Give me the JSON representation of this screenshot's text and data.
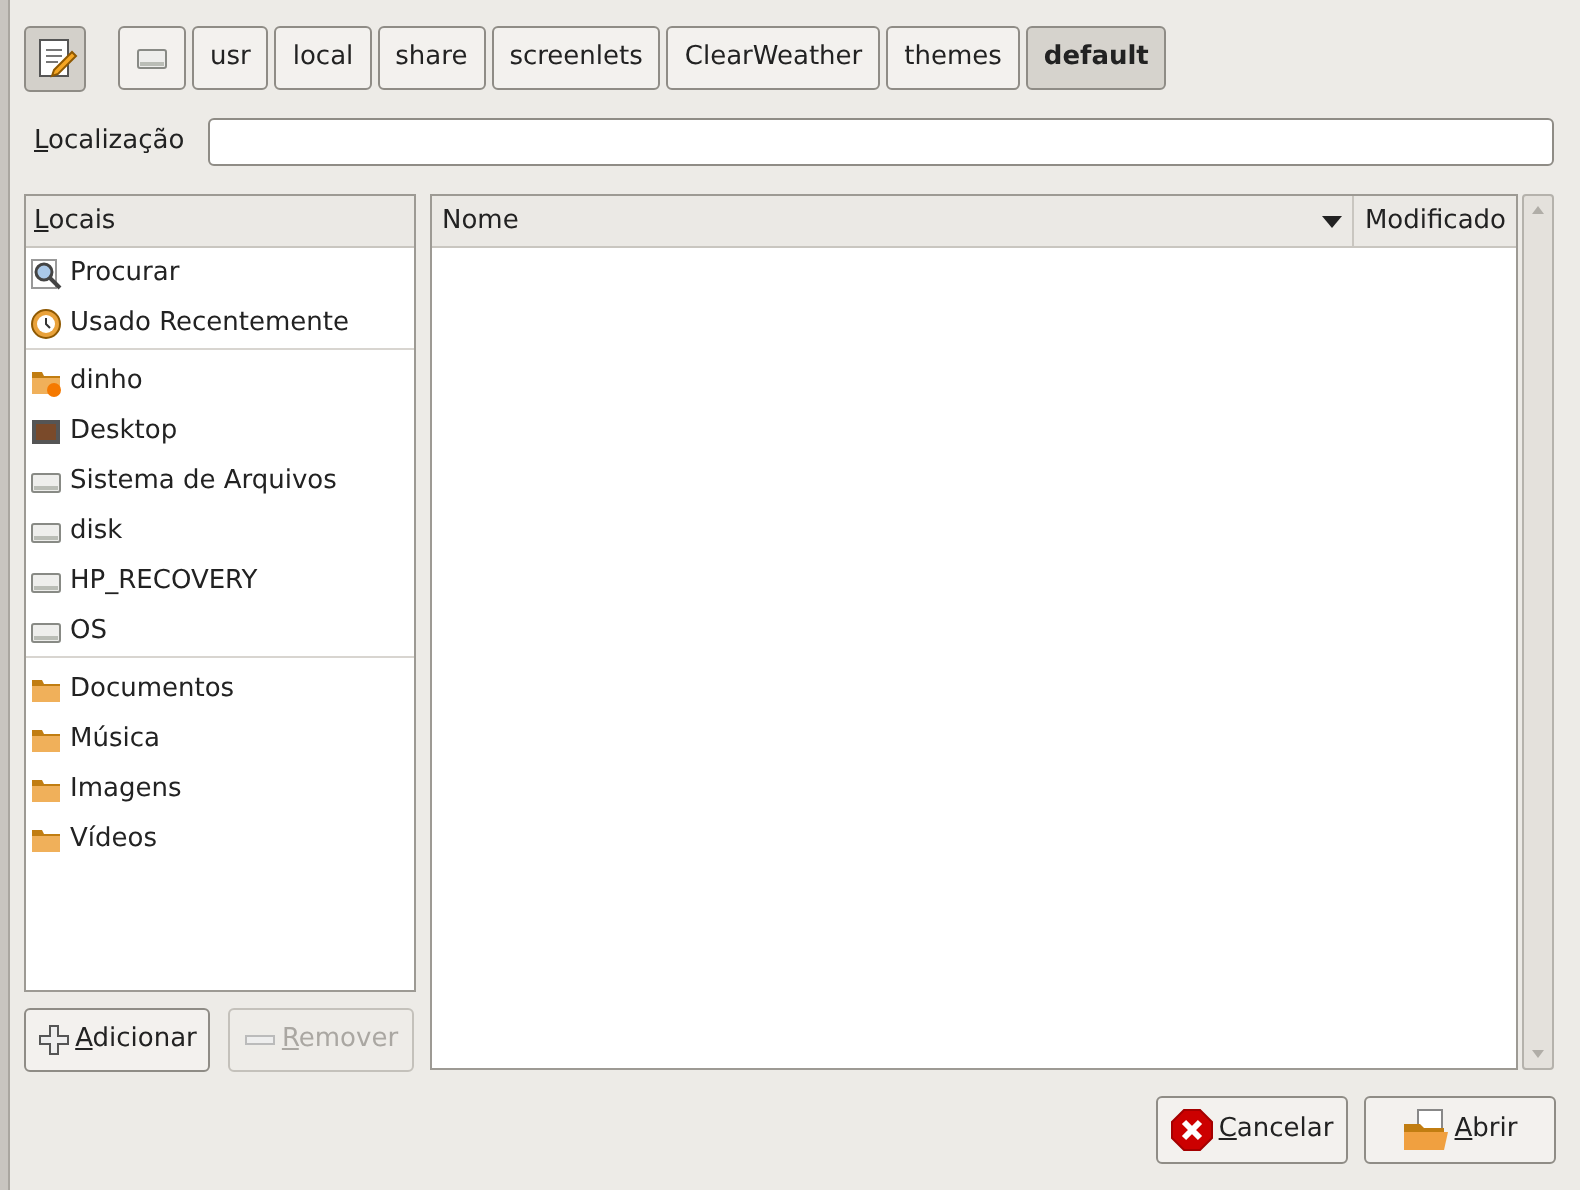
{
  "path_bar": {
    "edit_toggle": {
      "pressed": true
    },
    "segments": [
      {
        "kind": "drive",
        "selected": false
      },
      {
        "kind": "text",
        "label": "usr",
        "selected": false
      },
      {
        "kind": "text",
        "label": "local",
        "selected": false
      },
      {
        "kind": "text",
        "label": "share",
        "selected": false
      },
      {
        "kind": "text",
        "label": "screenlets",
        "selected": false
      },
      {
        "kind": "text",
        "label": "ClearWeather",
        "selected": false
      },
      {
        "kind": "text",
        "label": "themes",
        "selected": false
      },
      {
        "kind": "text",
        "label": "default",
        "selected": true
      }
    ]
  },
  "location": {
    "label": "Localização"
  },
  "places": {
    "header": "Locais",
    "groups": [
      [
        {
          "kind": "search",
          "label": "Procurar"
        },
        {
          "kind": "recent",
          "label": "Usado Recentemente"
        }
      ],
      [
        {
          "kind": "home",
          "label": "dinho"
        },
        {
          "kind": "desktop",
          "label": "Desktop"
        },
        {
          "kind": "drive",
          "label": "Sistema de Arquivos"
        },
        {
          "kind": "drive",
          "label": "disk"
        },
        {
          "kind": "drive",
          "label": "HP_RECOVERY"
        },
        {
          "kind": "drive",
          "label": "OS"
        }
      ],
      [
        {
          "kind": "folder",
          "label": "Documentos"
        },
        {
          "kind": "folder",
          "label": "Música"
        },
        {
          "kind": "folder",
          "label": "Imagens"
        },
        {
          "kind": "folder",
          "label": "Vídeos"
        }
      ]
    ],
    "buttons": [
      {
        "kind": "add",
        "label": "Adicionar",
        "disabled": false
      },
      {
        "kind": "remove",
        "label": "Remover",
        "disabled": true
      }
    ]
  },
  "files": {
    "columns": [
      {
        "label": "Nome",
        "sorted": true
      },
      {
        "label": "Modificado",
        "sorted": false
      }
    ]
  },
  "actions": [
    {
      "kind": "cancel",
      "label": "Cancelar"
    },
    {
      "kind": "open",
      "label": "Abrir"
    }
  ]
}
